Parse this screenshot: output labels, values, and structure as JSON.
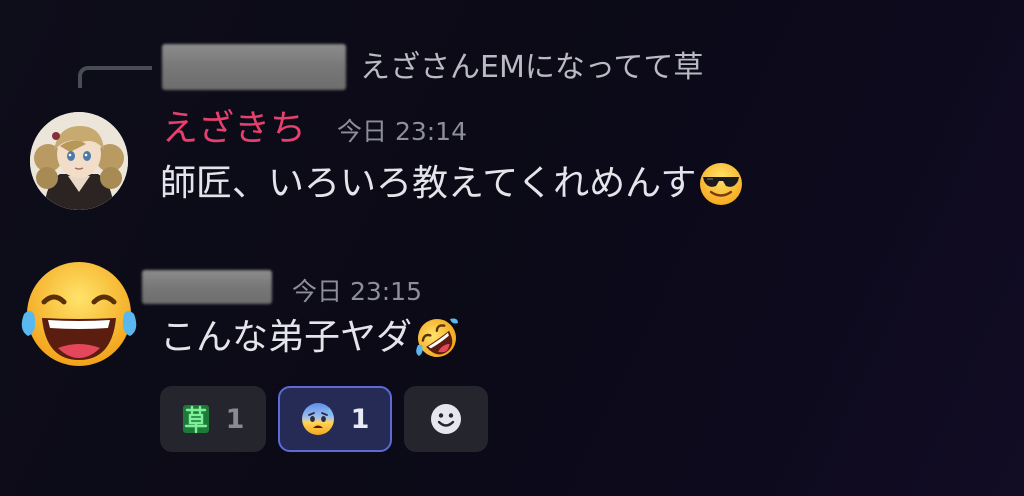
{
  "reply": {
    "text": "えざさんEMになってて草"
  },
  "message1": {
    "author": "えざきち",
    "timestamp": "今日 23:14",
    "text": "師匠、いろいろ教えてくれめんす",
    "emoji": "smiling-face-with-sunglasses"
  },
  "message2": {
    "timestamp": "今日 23:15",
    "text": "こんな弟子ヤダ",
    "emoji": "rolling-on-the-floor-laughing",
    "avatar_emoji": "face-with-tears-of-joy"
  },
  "reactions": [
    {
      "icon": "kusa-custom-emoji",
      "count": "1",
      "selected": false
    },
    {
      "icon": "anxious-face-with-sweat",
      "count": "1",
      "selected": true
    },
    {
      "icon": "add-reaction-icon"
    }
  ]
}
